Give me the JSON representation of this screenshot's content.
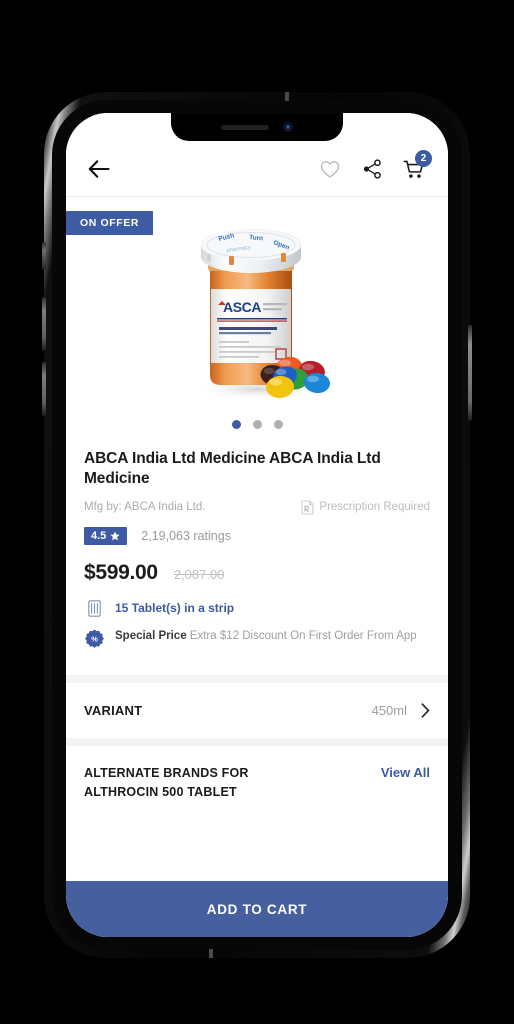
{
  "app": {
    "topbar": {
      "back_icon": "arrow-left-icon",
      "wishlist_icon": "heart-icon",
      "share_icon": "share-icon",
      "cart_icon": "cart-icon",
      "cart_count": "2"
    },
    "gallery": {
      "offer_badge": "ON OFFER",
      "image_alt": "pill-bottle-with-colored-tablets",
      "dots_total": 3,
      "active_dot_index": 0
    },
    "product": {
      "title": "ABCA India Ltd Medicine ABCA India Ltd Medicine",
      "manufacturer": "Mfg by: ABCA India Ltd.",
      "prescription_label": "Prescription Required",
      "prescription_icon": "prescription-document-icon",
      "rating_value": "4.5",
      "rating_star_icon": "star-icon",
      "ratings_count": "2,19,063 ratings",
      "price_current": "$599.00",
      "price_original": "2,087.00",
      "pack_info": "15 Tablet(s) in a strip",
      "pack_icon": "tablet-strip-icon",
      "offer_icon": "percent-badge-icon",
      "offer_label": "Special Price",
      "offer_text": " Extra $12 Discount On First Order From App"
    },
    "variant": {
      "label": "VARIANT",
      "value": "450ml",
      "chevron_icon": "chevron-right-icon"
    },
    "alternate_brands": {
      "title": "ALTERNATE BRANDS FOR ALTHROCIN 500 TABLET",
      "view_all": "View All"
    },
    "cta": {
      "add_to_cart": "ADD TO CART"
    },
    "colors": {
      "brand_blue": "#3c5ba4",
      "cta_blue": "#465f9e",
      "offer_badge_blue": "#3e5ca3",
      "muted_text": "#9d9d9d",
      "separator": "#f3f3f5"
    }
  }
}
